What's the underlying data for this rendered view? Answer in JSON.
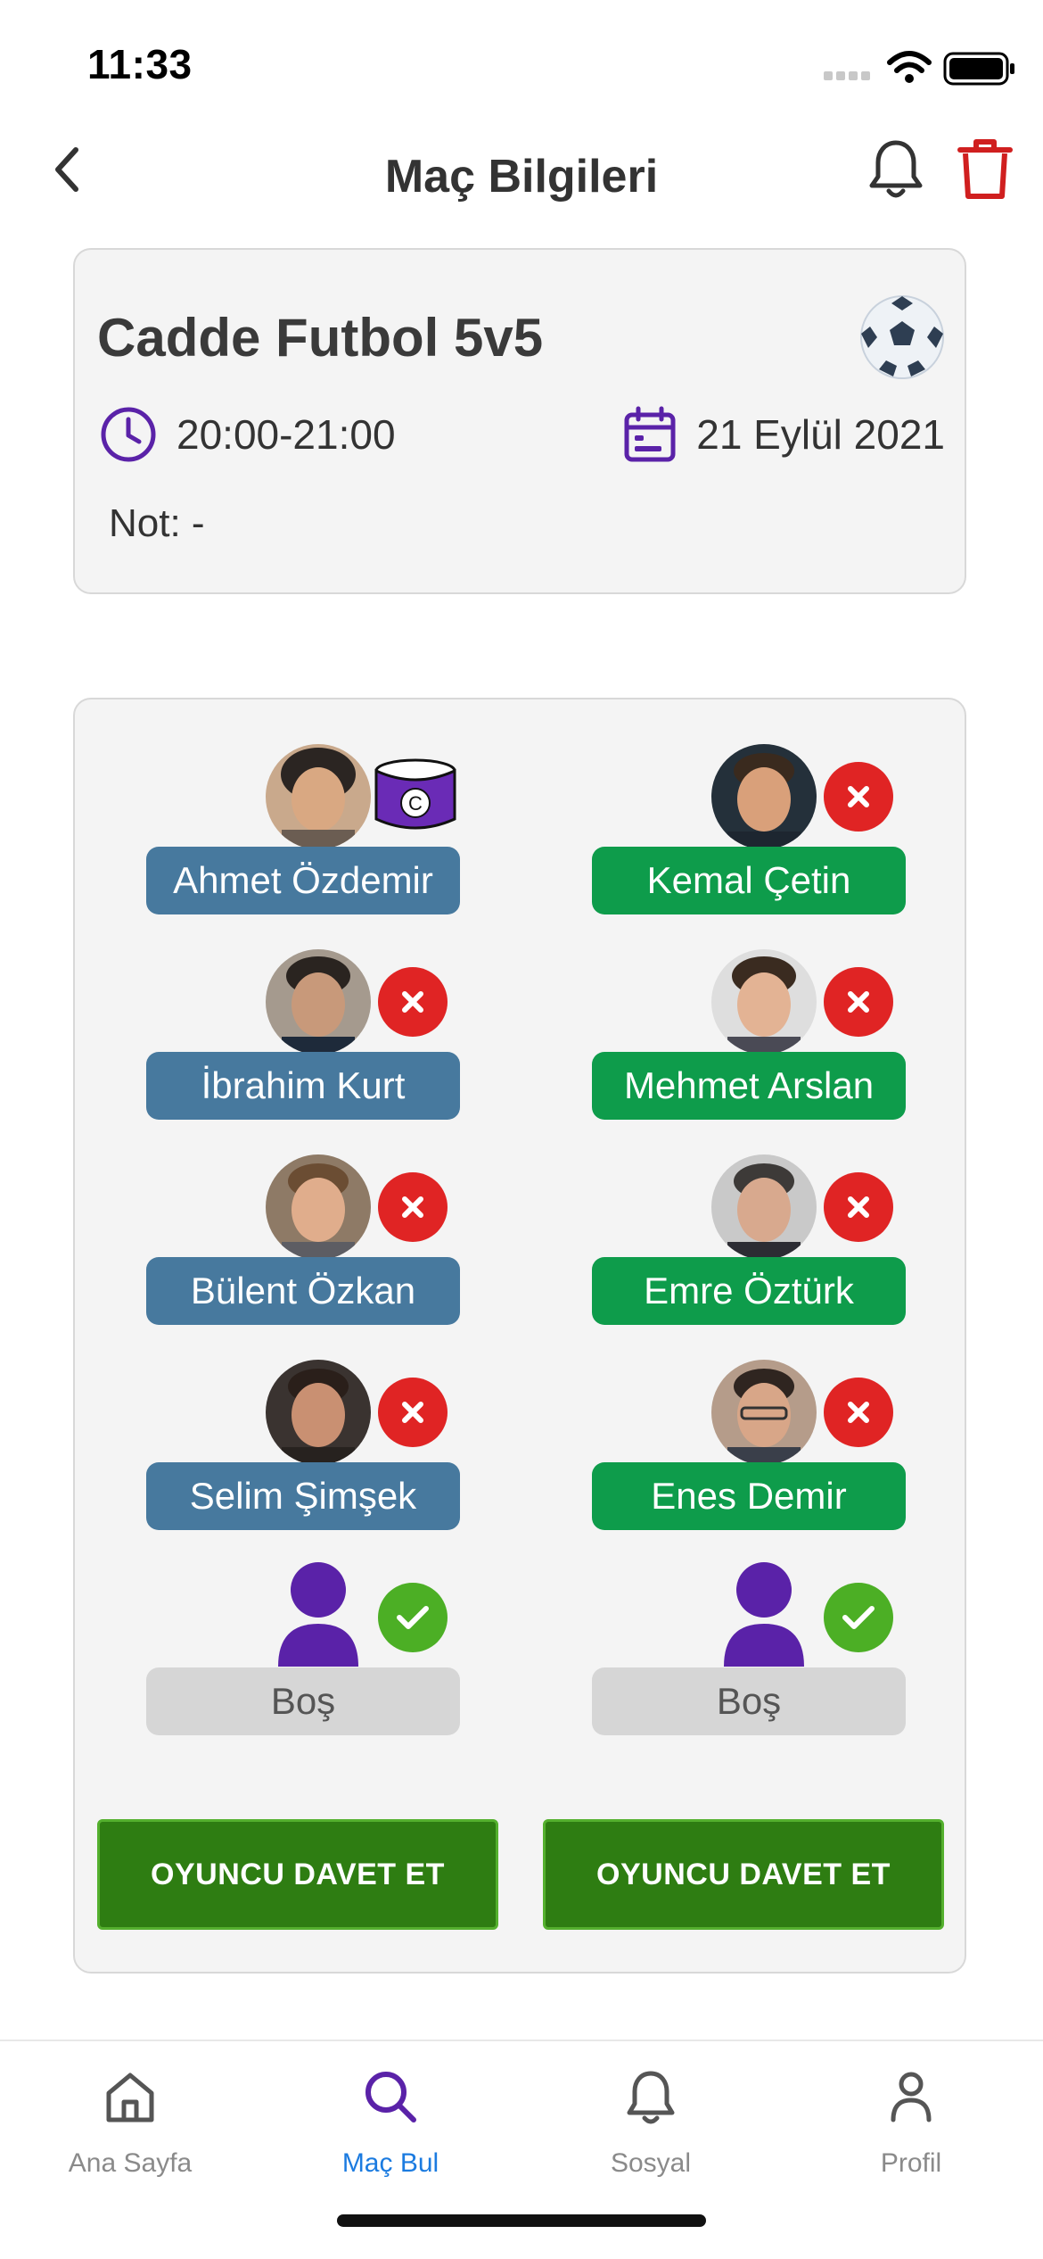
{
  "status_bar": {
    "time": "11:33"
  },
  "header": {
    "title": "Maç Bilgileri"
  },
  "match": {
    "title": "Cadde Futbol 5v5",
    "time": "20:00-21:00",
    "date": "21 Eylül 2021",
    "note": "Not: -"
  },
  "team_a": {
    "color": "#47799e",
    "players": [
      {
        "name": "Ahmet Özdemir",
        "captain_label": "C"
      },
      {
        "name": "İbrahim Kurt"
      },
      {
        "name": "Bülent Özkan"
      },
      {
        "name": "Selim Şimşek"
      },
      {
        "name": "Boş"
      }
    ],
    "invite_label": "OYUNCU DAVET ET"
  },
  "team_b": {
    "color": "#0e9c4b",
    "players": [
      {
        "name": "Kemal Çetin"
      },
      {
        "name": "Mehmet Arslan"
      },
      {
        "name": "Emre Öztürk"
      },
      {
        "name": "Enes Demir"
      },
      {
        "name": "Boş"
      }
    ],
    "invite_label": "OYUNCU DAVET ET"
  },
  "tabs": [
    {
      "label": "Ana Sayfa",
      "icon": "home-icon"
    },
    {
      "label": "Maç Bul",
      "icon": "search-icon",
      "active": true
    },
    {
      "label": "Sosyal",
      "icon": "bell-icon"
    },
    {
      "label": "Profil",
      "icon": "profile-icon"
    }
  ],
  "colors": {
    "accent_purple": "#5a22a8",
    "remove_red": "#e02424",
    "add_green": "#4caf25",
    "invite_green": "#2e7d12",
    "active_tab_blue": "#1b7be0"
  }
}
